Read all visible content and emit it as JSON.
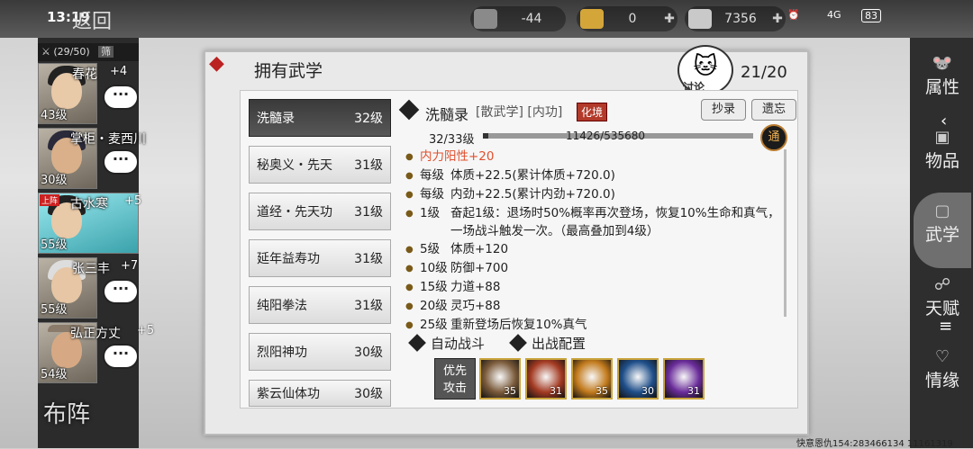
{
  "status_bar": {
    "time": "13:19",
    "back_label": "返回",
    "battery": "83",
    "net": "4G"
  },
  "resources": [
    {
      "icon": "cart-icon",
      "value": "-44"
    },
    {
      "icon": "gold-icon",
      "value": "0"
    },
    {
      "icon": "silver-icon",
      "value": "7356"
    }
  ],
  "team": {
    "count": "(29/50)",
    "action": "筛"
  },
  "characters": [
    {
      "name": "春花",
      "bonus": "+4",
      "level": "43级"
    },
    {
      "name": "掌柜・麦西川",
      "bonus": "",
      "level": "30级"
    },
    {
      "name": "古水寒",
      "bonus": "+5",
      "level": "55级",
      "tag": "上阵"
    },
    {
      "name": "张三丰",
      "bonus": "+7",
      "level": "55级"
    },
    {
      "name": "弘正方丈",
      "bonus": "+5",
      "level": "54级"
    }
  ],
  "formation_label": "布阵",
  "panel": {
    "title": "拥有武学",
    "count": "21/20",
    "discuss_label": "讨论"
  },
  "skill_list": [
    {
      "name": "洗髓录",
      "level": "32级"
    },
    {
      "name": "秘奥义・先天",
      "level": "31级"
    },
    {
      "name": "道经・先天功",
      "level": "31级"
    },
    {
      "name": "延年益寿功",
      "level": "31级"
    },
    {
      "name": "纯阳拳法",
      "level": "31级"
    },
    {
      "name": "烈阳神功",
      "level": "30级"
    },
    {
      "name": "紫云仙体功",
      "level": "30级"
    }
  ],
  "detail": {
    "name": "洗髓录",
    "tags": "[散武学] [内功]",
    "realm": "化境",
    "copy_label": "抄录",
    "forget_label": "遗忘",
    "level_progress": "32/33级",
    "exp": "11426/535680",
    "exp_fraction": 0.021,
    "tong_label": "通",
    "effects": [
      {
        "key": "",
        "value": "内力阳性+20",
        "highlight": true
      },
      {
        "key": "每级",
        "value": "体质+22.5(累计体质+720.0)"
      },
      {
        "key": "每级",
        "value": "内劲+22.5(累计内劲+720.0)"
      },
      {
        "key": "1级",
        "value": "奋起1级：退场时50%概率再次登场，恢复10%生命和真气，一场战斗触发一次。（最高叠加到4级）"
      },
      {
        "key": "5级",
        "value": "体质+120"
      },
      {
        "key": "10级",
        "value": "防御+700"
      },
      {
        "key": "15级",
        "value": "力道+88"
      },
      {
        "key": "20级",
        "value": "灵巧+88"
      },
      {
        "key": "25级",
        "value": "重新登场后恢复10%真气"
      }
    ],
    "auto_battle_label": "自动战斗",
    "battle_config_label": "出战配置",
    "priority_label_1": "优先",
    "priority_label_2": "攻击",
    "skills": [
      {
        "num": "35",
        "color": "#7a5a3a"
      },
      {
        "num": "31",
        "color": "#a33a22"
      },
      {
        "num": "35",
        "color": "#c27a1c"
      },
      {
        "num": "30",
        "color": "#1f4f8a"
      },
      {
        "num": "31",
        "color": "#6a2c9a"
      }
    ]
  },
  "nav": [
    {
      "label": "属性",
      "icon": "rat-icon"
    },
    {
      "label": "物品",
      "icon": "box-icon"
    },
    {
      "label": "武学",
      "icon": "scroll-icon"
    },
    {
      "label": "天赋",
      "icon": "gourd-icon"
    },
    {
      "label": "情缘",
      "icon": "heart-icon"
    }
  ],
  "footer": "快意恩仇154:283466134 11161319"
}
